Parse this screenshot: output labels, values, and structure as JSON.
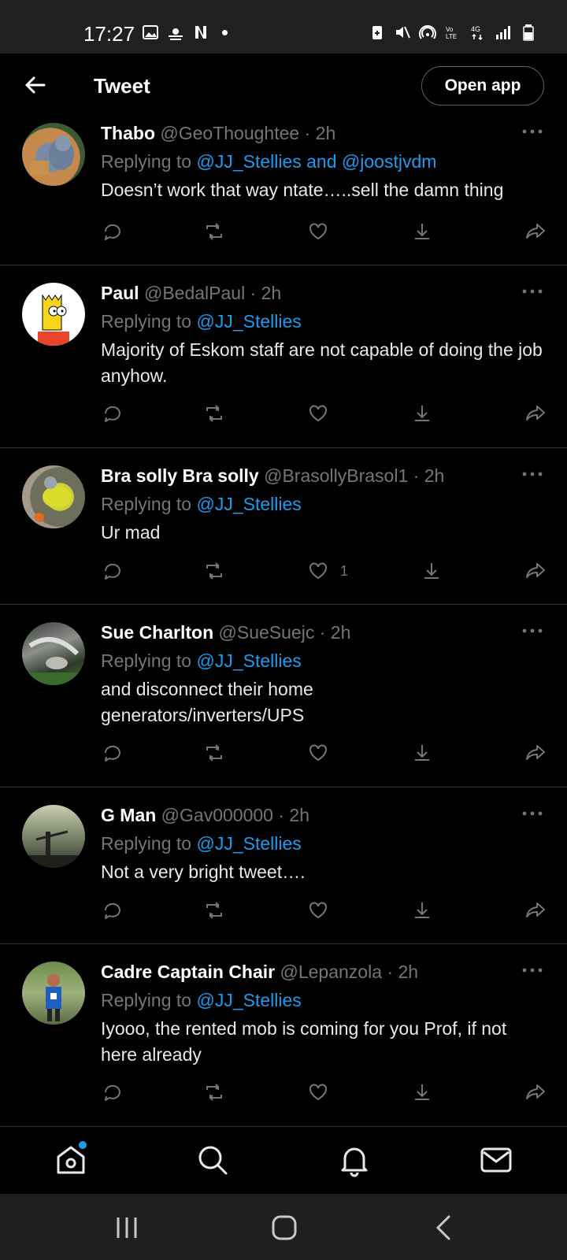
{
  "status_bar": {
    "time": "17:27"
  },
  "header": {
    "title": "Tweet",
    "open_app_label": "Open app"
  },
  "tweets": [
    {
      "name": "Thabo",
      "handle": "@GeoThoughtee",
      "time": "2h",
      "replying_prefix": "Replying to ",
      "replying_to": "@JJ_Stellies and @joostjvdm",
      "text": "Doesn’t work that way ntate…..sell the damn thing",
      "likes": ""
    },
    {
      "name": "Paul",
      "handle": "@BedalPaul",
      "time": "2h",
      "replying_prefix": "Replying to ",
      "replying_to": "@JJ_Stellies",
      "text": "Majority of Eskom staff are not capable of doing the job anyhow.",
      "likes": ""
    },
    {
      "name": "Bra solly Bra solly",
      "handle": "@BrasollyBrasol1",
      "time": "2h",
      "replying_prefix": "Replying to ",
      "replying_to": "@JJ_Stellies",
      "text": "Ur mad",
      "likes": "1"
    },
    {
      "name": "Sue Charlton",
      "handle": "@SueSuejc",
      "time": "2h",
      "replying_prefix": "Replying to ",
      "replying_to": "@JJ_Stellies",
      "text": "and disconnect their home generators/inverters/UPS",
      "likes": ""
    },
    {
      "name": "G Man",
      "handle": "@Gav000000",
      "time": "2h",
      "replying_prefix": "Replying to ",
      "replying_to": "@JJ_Stellies",
      "text": "Not a very bright tweet….",
      "likes": ""
    },
    {
      "name": "Cadre Captain Chair",
      "handle": "@Lepanzola",
      "time": "2h",
      "replying_prefix": "Replying to ",
      "replying_to": "@JJ_Stellies",
      "text": "Iyooo, the rented mob is coming for you Prof, if not here already",
      "likes": ""
    }
  ],
  "bottom_nav": {
    "items": [
      {
        "icon": "home-icon"
      },
      {
        "icon": "search-icon"
      },
      {
        "icon": "notifications-icon"
      },
      {
        "icon": "messages-icon"
      }
    ]
  },
  "colors": {
    "background": "#000000",
    "accent": "#1d9bf0",
    "muted": "#71767b",
    "divider": "#2f3336"
  }
}
